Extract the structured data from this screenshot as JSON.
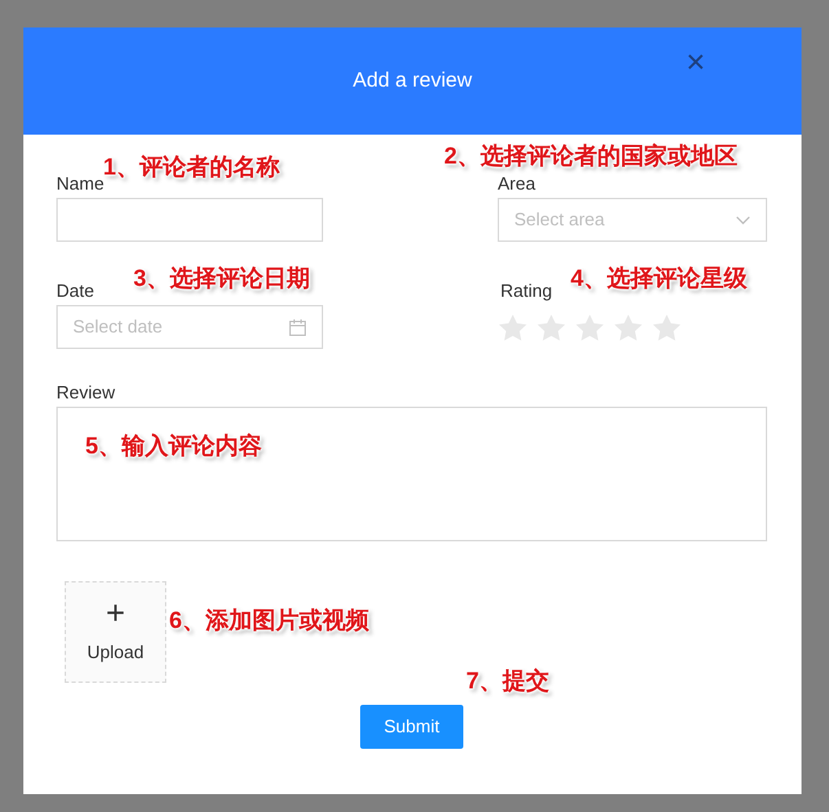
{
  "dialog": {
    "title": "Add a review",
    "close": "×"
  },
  "form": {
    "name": {
      "label": "Name"
    },
    "area": {
      "label": "Area",
      "placeholder": "Select area"
    },
    "date": {
      "label": "Date",
      "placeholder": "Select date"
    },
    "rating": {
      "label": "Rating",
      "stars": 0
    },
    "review": {
      "label": "Review"
    },
    "upload": {
      "label": "Upload",
      "icon": "+"
    },
    "submit": "Submit"
  },
  "annotations": [
    {
      "text": "1、评论者的名称"
    },
    {
      "text": "2、选择评论者的国家或地区"
    },
    {
      "text": "3、选择评论日期"
    },
    {
      "text": "4、选择评论星级"
    },
    {
      "text": "5、输入评论内容"
    },
    {
      "text": "6、添加图片或视频"
    },
    {
      "text": "7、提交"
    }
  ]
}
